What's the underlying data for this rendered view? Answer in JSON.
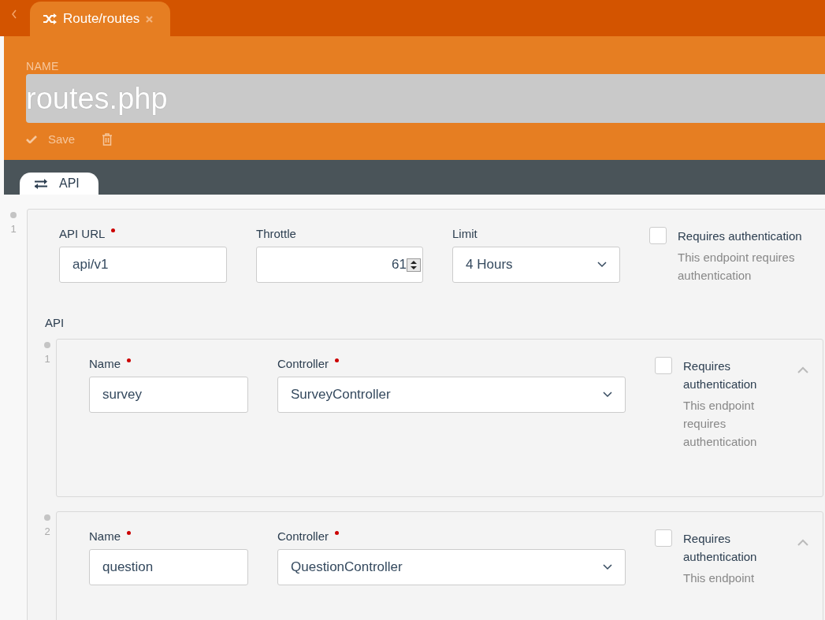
{
  "tab": {
    "label": "Route/routes"
  },
  "name_field": {
    "label": "NAME",
    "value": "routes.php"
  },
  "actions": {
    "save": "Save"
  },
  "section_tabs": [
    {
      "label": "API",
      "selected": true
    }
  ],
  "entries": [
    {
      "number": "1",
      "expanded": true,
      "fields": [
        {
          "kind": "text",
          "label": "API URL",
          "required": true,
          "value": "api/v1"
        },
        {
          "kind": "number",
          "label": "Throttle",
          "required": false,
          "value": "61"
        },
        {
          "kind": "select",
          "label": "Limit",
          "required": false,
          "value": "4 Hours"
        }
      ],
      "auth": {
        "label": "Requires authentication",
        "checked": false,
        "description": "This endpoint requires authentication"
      },
      "list_label": "API",
      "items": [
        {
          "number": "1",
          "expanded": true,
          "fields": [
            {
              "kind": "text",
              "label": "Name",
              "required": true,
              "value": "survey"
            },
            {
              "kind": "select",
              "label": "Controller",
              "required": true,
              "value": "SurveyController"
            }
          ],
          "auth": {
            "label": "Requires authentication",
            "checked": false,
            "description": "This endpoint requires authentication"
          }
        },
        {
          "number": "2",
          "expanded": true,
          "fields": [
            {
              "kind": "text",
              "label": "Name",
              "required": true,
              "value": "question"
            },
            {
              "kind": "select",
              "label": "Controller",
              "required": true,
              "value": "QuestionController"
            }
          ],
          "auth": {
            "label": "Requires authentication",
            "checked": false,
            "description": "This endpoint"
          }
        }
      ]
    }
  ]
}
